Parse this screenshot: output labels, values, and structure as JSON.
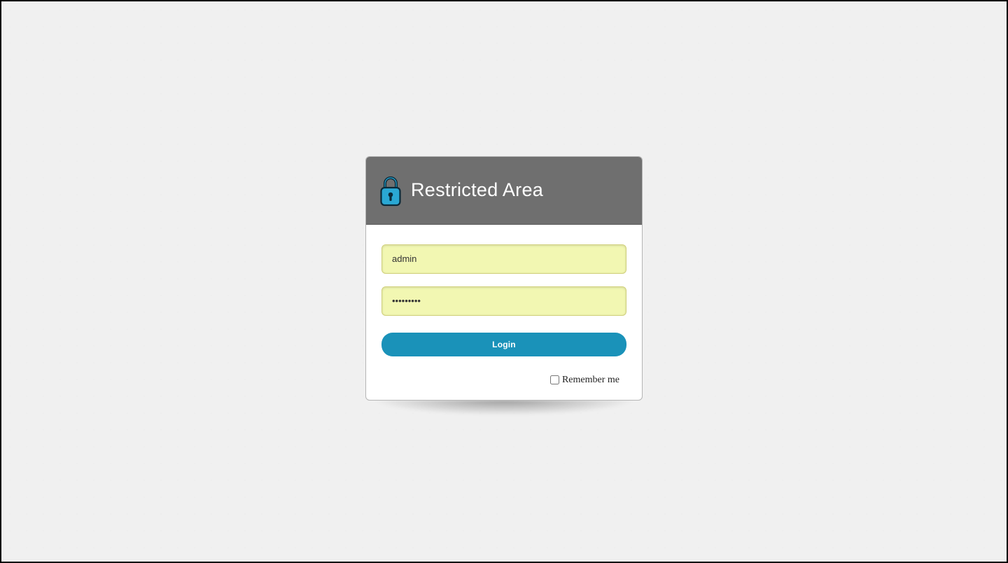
{
  "login": {
    "title": "Restricted Area",
    "username_value": "admin",
    "username_placeholder": "",
    "password_value": "password1",
    "password_placeholder": "",
    "button_label": "Login",
    "remember_label": "Remember me",
    "remember_checked": false
  },
  "colors": {
    "header_bg": "#6f6f6f",
    "accent": "#1a92b9",
    "input_autofill_bg": "#f2f7b2",
    "lock_fill": "#2aa8d4",
    "lock_stroke": "#0a2a3a"
  }
}
